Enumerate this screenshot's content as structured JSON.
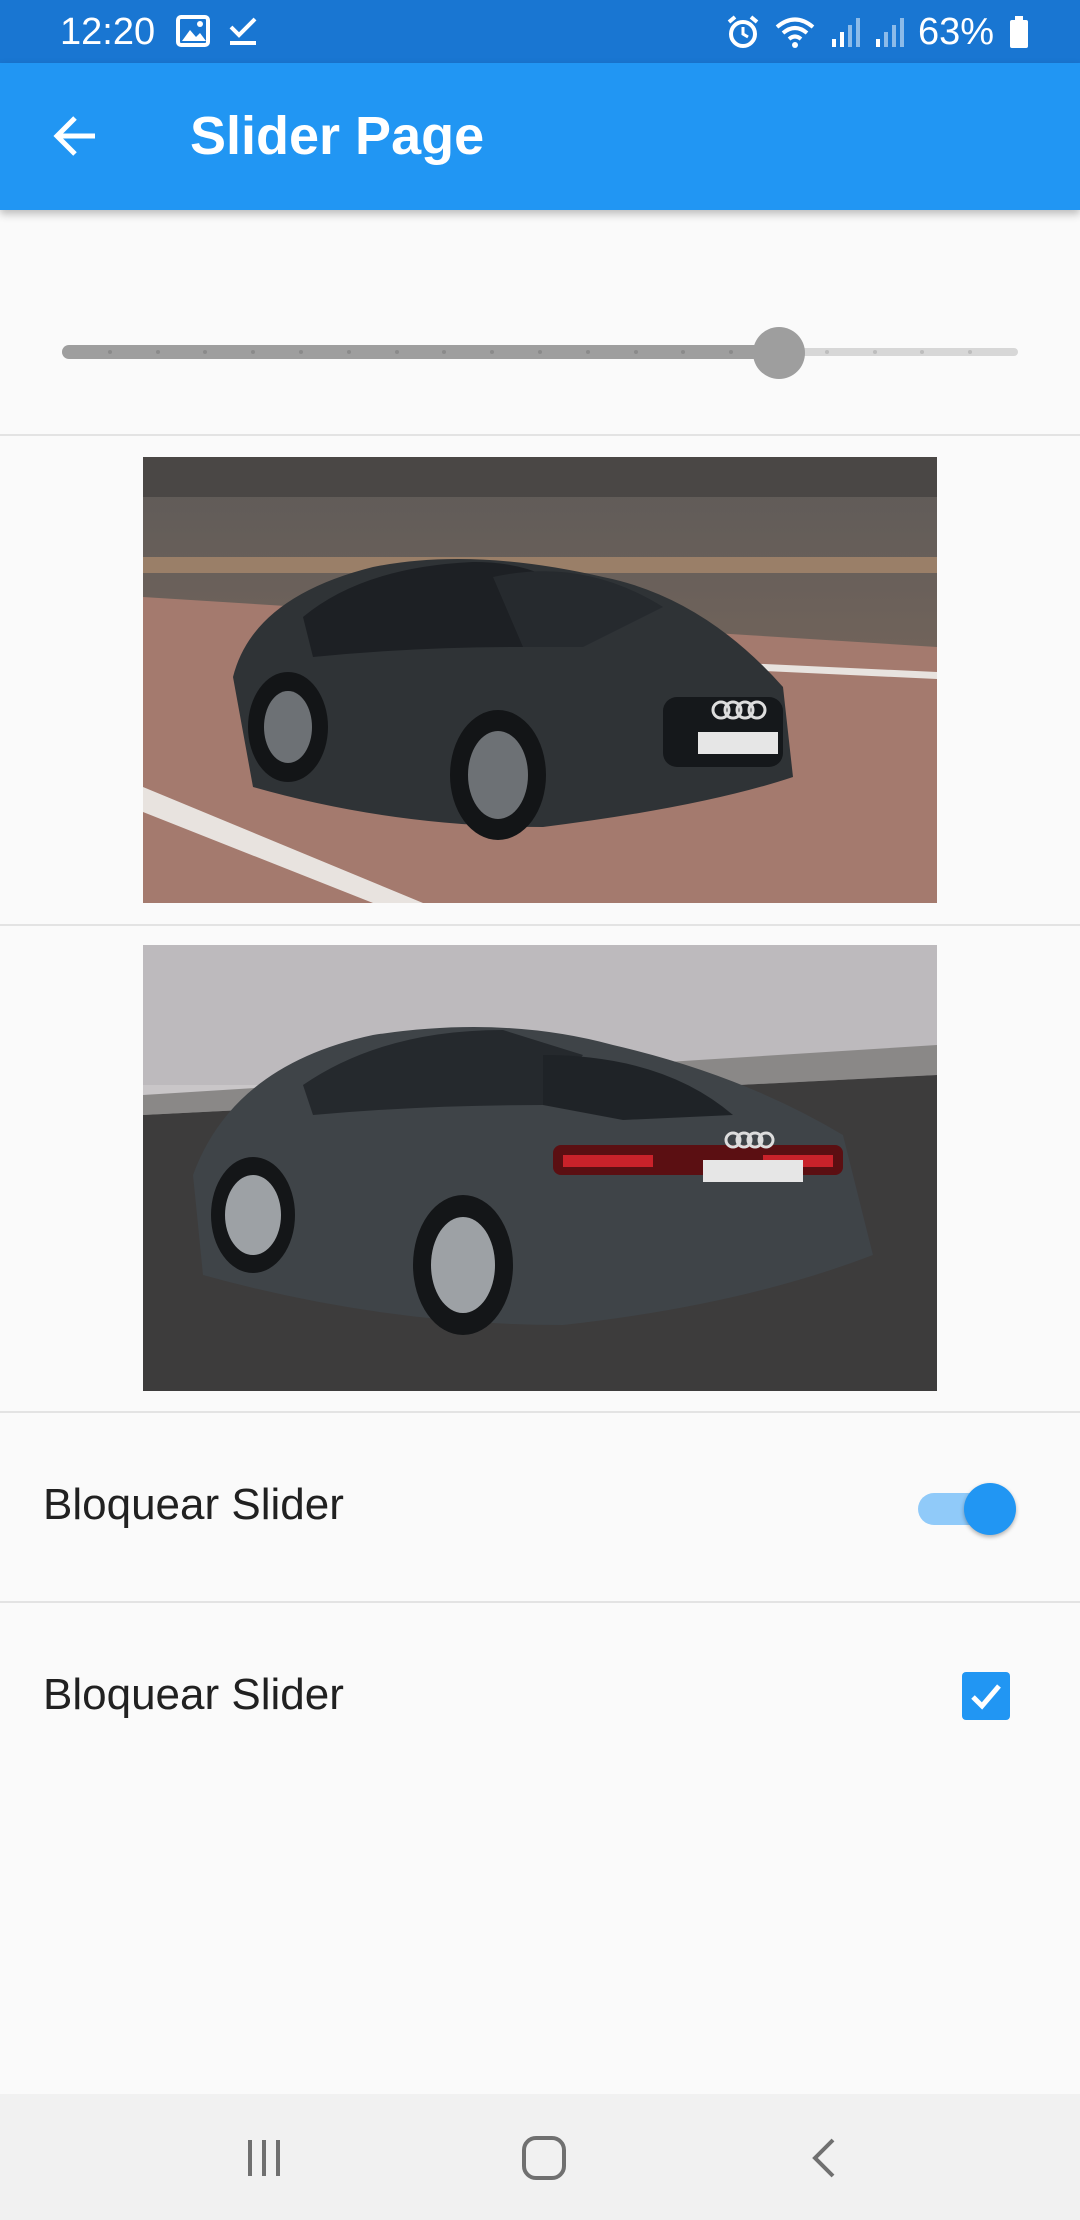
{
  "status_bar": {
    "time": "12:20",
    "battery_percent": "63%",
    "icons": [
      "image-icon",
      "checkmark-icon",
      "alarm-icon",
      "wifi-icon",
      "signal-icon",
      "signal-icon",
      "battery-icon"
    ]
  },
  "appbar": {
    "title": "Slider Page",
    "back_icon": "arrow-back-icon",
    "color": "#2196f3"
  },
  "slider": {
    "value_fraction": 0.75,
    "divisions": 20,
    "enabled": false
  },
  "images": [
    {
      "name": "car-front-image",
      "icon": "car-image"
    },
    {
      "name": "car-rear-image",
      "icon": "car-image"
    }
  ],
  "options": {
    "switch_label": "Bloquear Slider",
    "switch_on": true,
    "checkbox_label": "Bloquear Slider",
    "checkbox_checked": true
  },
  "nav_bar": {
    "recent_icon": "recent-apps-icon",
    "home_icon": "home-icon",
    "back_icon": "back-icon"
  }
}
